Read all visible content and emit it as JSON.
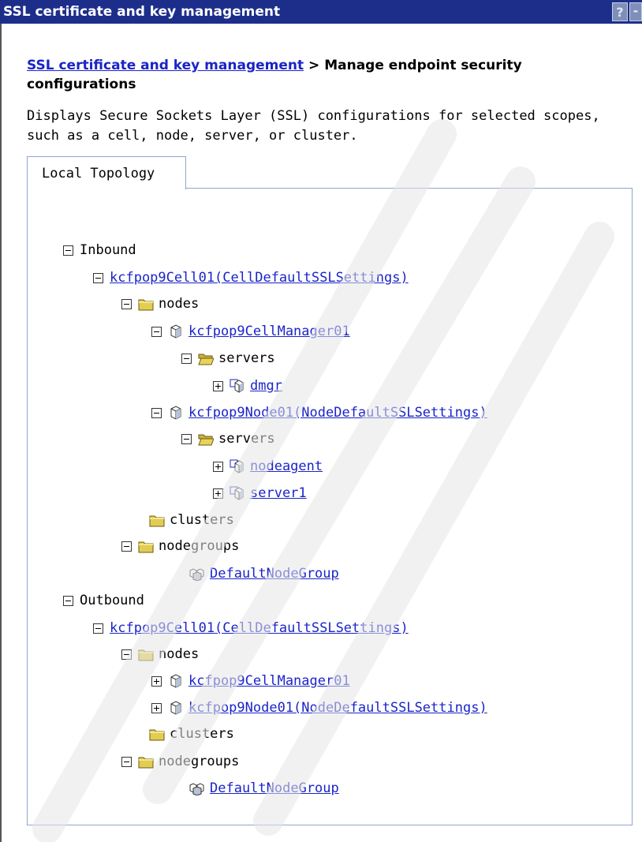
{
  "window": {
    "title": "SSL certificate and key management",
    "help_glyph": "?",
    "minimize_glyph": "-"
  },
  "breadcrumb": {
    "link": "SSL certificate and key management",
    "separator": ">",
    "current": "Manage endpoint security configurations"
  },
  "description": "Displays Secure Sockets Layer (SSL) configurations for selected scopes, such as a cell, node, server, or cluster.",
  "tabs": [
    {
      "label": "Local Topology"
    }
  ],
  "tree": {
    "inbound": {
      "label": "Inbound",
      "cell": "kcfpop9Cell01(CellDefaultSSLSettings)",
      "nodes": "nodes",
      "cell_manager": "kcfpop9CellManager01",
      "servers_1": "servers",
      "dmgr": "dmgr",
      "node01": "kcfpop9Node01(NodeDefaultSSLSettings)",
      "servers_2": "servers",
      "nodeagent": "nodeagent",
      "server1": "server1",
      "clusters": "clusters",
      "nodegroups": "nodegroups",
      "default_node_group": "DefaultNodeGroup"
    },
    "outbound": {
      "label": "Outbound",
      "cell": "kcfpop9Cell01(CellDefaultSSLSettings)",
      "nodes": "nodes",
      "cell_manager": "kcfpop9CellManager01",
      "node01": "kcfpop9Node01(NodeDefaultSSLSettings)",
      "clusters": "clusters",
      "nodegroups": "nodegroups",
      "default_node_group": "DefaultNodeGroup"
    }
  },
  "icons": {
    "expanded_toggle": "minus-box-icon",
    "collapsed_toggle": "plus-box-icon",
    "folder": "folder-icon",
    "open_folder": "open-folder-icon",
    "node": "node-cube-icon",
    "server": "server-icon",
    "node_group": "node-group-icon"
  },
  "colors": {
    "titlebar": "#1d2e8a",
    "link": "#1a24c8",
    "tab_border": "#8fa6cf",
    "folder": "#e2cc52"
  }
}
